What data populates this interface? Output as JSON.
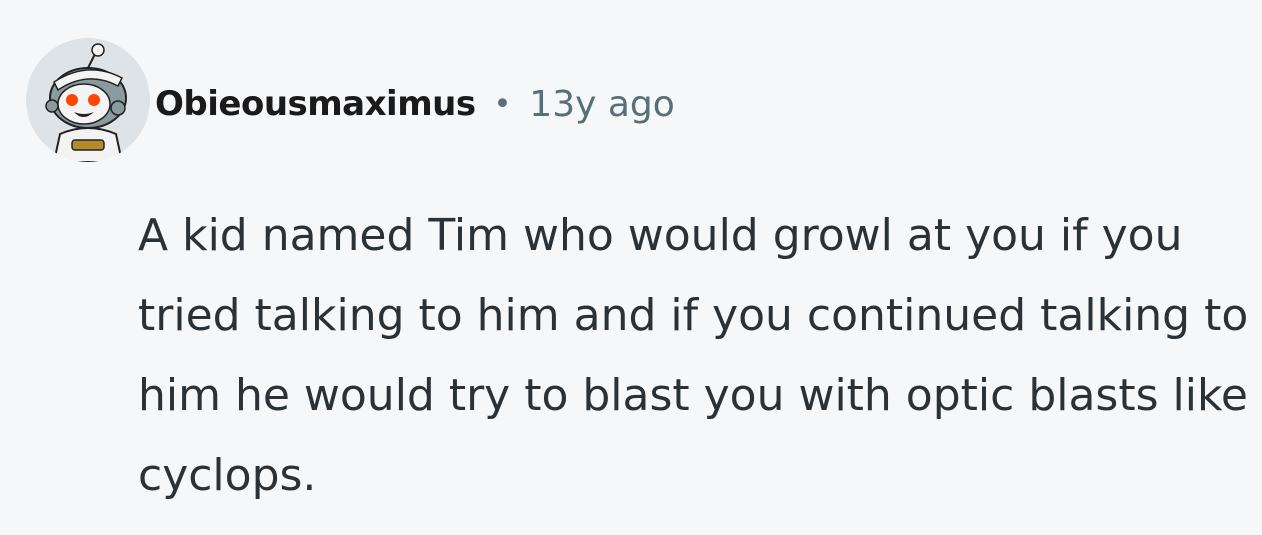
{
  "comment": {
    "author": "Obieousmaximus",
    "separator": "•",
    "timestamp": "13y ago",
    "body": "A kid named Tim who would growl at you if you tried talking to him and if you continued talking to him he would try to blast you with optic blasts like cyclops."
  },
  "avatar": {
    "icon": "snoo-avatar-icon"
  }
}
